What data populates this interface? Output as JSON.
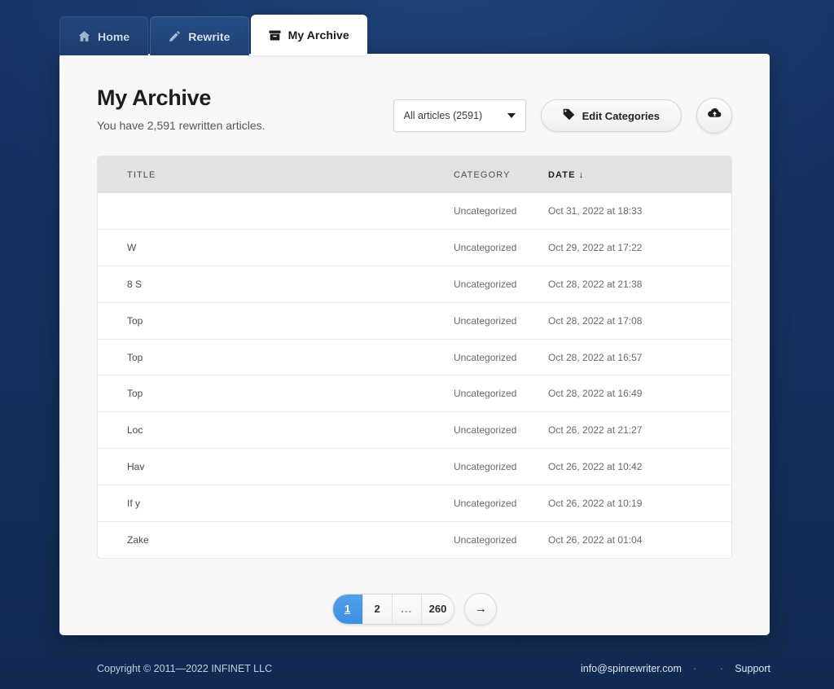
{
  "tabs": [
    {
      "label": "Home",
      "icon": "home-icon",
      "active": false
    },
    {
      "label": "Rewrite",
      "icon": "pencil-icon",
      "active": false
    },
    {
      "label": "My Archive",
      "icon": "archive-icon",
      "active": true
    }
  ],
  "header": {
    "title": "My Archive",
    "subtitle": "You have 2,591 rewritten articles.",
    "filter_select": {
      "value": "All articles (2591)",
      "caret_icon": "chevron-down-icon"
    },
    "edit_categories_label": "Edit Categories",
    "edit_categories_icon": "tag-icon",
    "upload_icon": "cloud-upload-icon"
  },
  "table": {
    "columns": [
      "TITLE",
      "CATEGORY",
      "DATE"
    ],
    "sort_column": "DATE",
    "sort_arrow": "↓",
    "rows": [
      {
        "title": "",
        "category": "Uncategorized",
        "date": "Oct 31, 2022 at 18:33"
      },
      {
        "title": "W",
        "category": "Uncategorized",
        "date": "Oct 29, 2022 at 17:22"
      },
      {
        "title": "8 S",
        "category": "Uncategorized",
        "date": "Oct 28, 2022 at 21:38"
      },
      {
        "title": "Top",
        "category": "Uncategorized",
        "date": "Oct 28, 2022 at 17:08"
      },
      {
        "title": "Top",
        "category": "Uncategorized",
        "date": "Oct 28, 2022 at 16:57"
      },
      {
        "title": "Top",
        "category": "Uncategorized",
        "date": "Oct 28, 2022 at 16:49"
      },
      {
        "title": "Loc",
        "category": "Uncategorized",
        "date": "Oct 26, 2022 at 21:27"
      },
      {
        "title": "Hav",
        "category": "Uncategorized",
        "date": "Oct 26, 2022 at 10:42"
      },
      {
        "title": "If y",
        "category": "Uncategorized",
        "date": "Oct 26, 2022 at 10:19"
      },
      {
        "title": "Zake",
        "category": "Uncategorized",
        "date": "Oct 26, 2022 at 01:04"
      }
    ]
  },
  "pagination": {
    "pages": [
      {
        "label": "1",
        "active": true
      },
      {
        "label": "2",
        "active": false
      },
      {
        "label": "...",
        "active": false
      },
      {
        "label": "260",
        "active": false
      }
    ],
    "next_label": "→"
  },
  "footer": {
    "copyright": "Copyright © 2011—2022 INFINET LLC",
    "email": "info@spinrewriter.com",
    "separator": "·",
    "blank_link": "",
    "support": "Support"
  },
  "colors": {
    "page_background": "#15305e",
    "card_background": "#f7f7f7",
    "accent_blue": "#3b8ee0",
    "active_tab_background": "#ffffff",
    "table_header_background": "#e2e2e2"
  }
}
